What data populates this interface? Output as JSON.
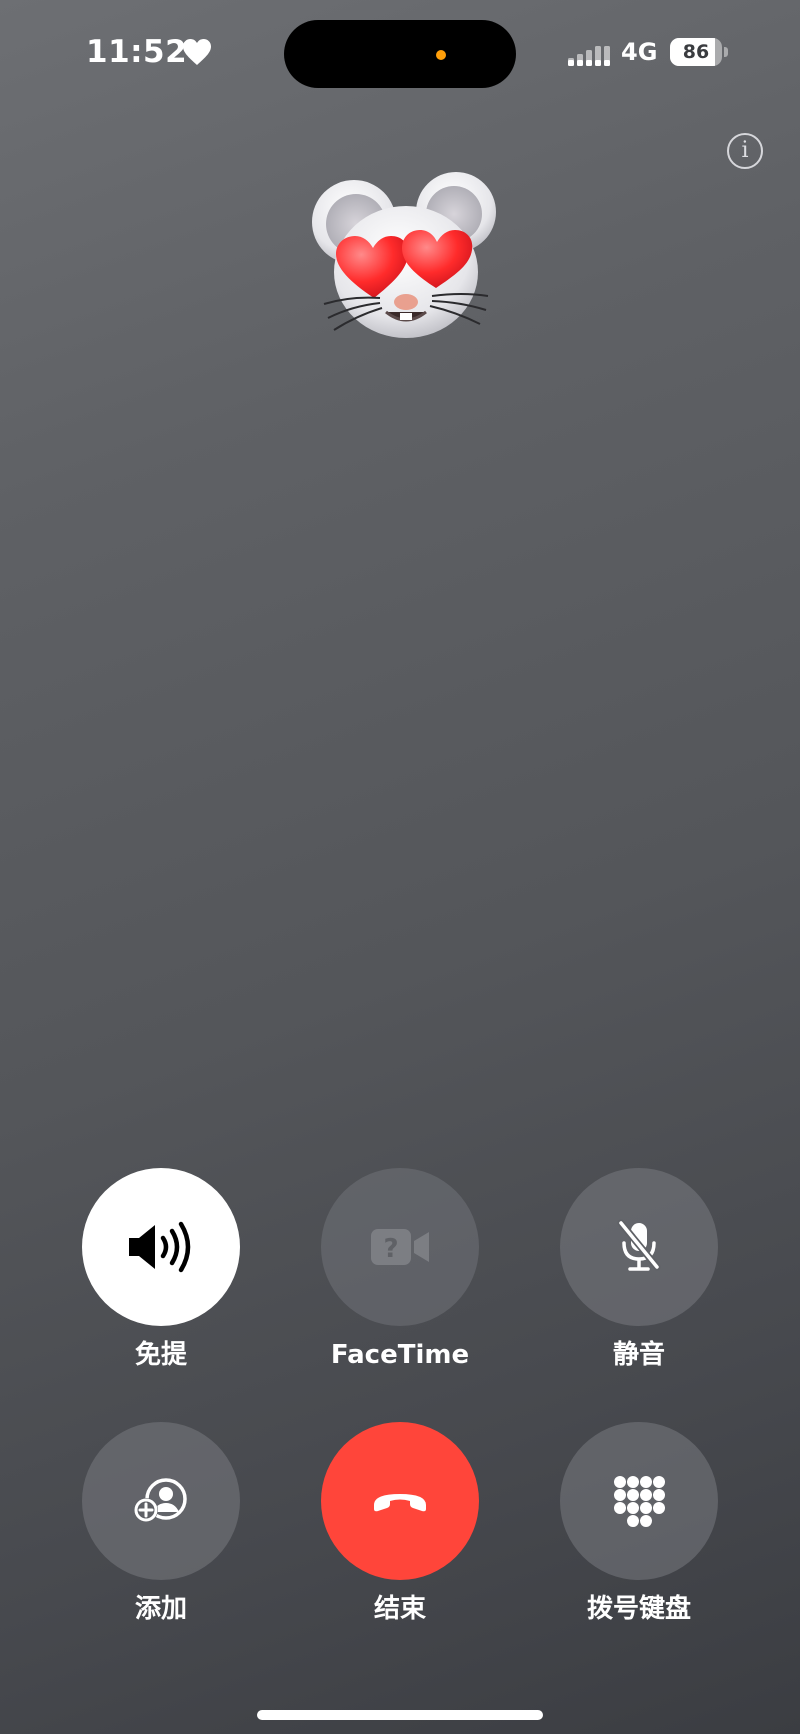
{
  "status_bar": {
    "time": "11:52",
    "heart_icon": "heart-icon",
    "signal_icon": "signal-icon",
    "network": "4G",
    "battery_percent": "86",
    "battery_level": 0.86
  },
  "info_button": {
    "icon": "info-icon",
    "glyph": "i"
  },
  "caller": {
    "avatar_icon": "memoji-mouse-heart-eyes-icon"
  },
  "controls": {
    "speaker": {
      "label": "免提",
      "icon": "speaker-icon",
      "active": true
    },
    "facetime": {
      "label": "FaceTime",
      "icon": "facetime-video-icon",
      "enabled": false
    },
    "mute": {
      "label": "静音",
      "icon": "mic-slash-icon"
    },
    "add_call": {
      "label": "添加",
      "icon": "add-person-icon"
    },
    "end_call": {
      "label": "结束",
      "icon": "end-call-icon"
    },
    "keypad": {
      "label": "拨号键盘",
      "icon": "keypad-icon"
    }
  },
  "colors": {
    "end_call": "#ff453a",
    "active_button": "#ffffff",
    "indicator_dot": "#ff9f0a"
  }
}
